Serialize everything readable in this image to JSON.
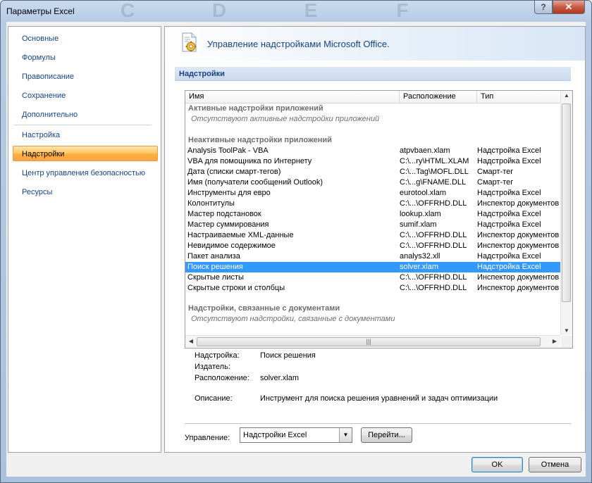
{
  "window": {
    "title": "Параметры Excel",
    "background_columns": [
      "C",
      "D",
      "E",
      "F"
    ],
    "help_glyph": "?",
    "close_glyph": "✕"
  },
  "nav": {
    "items": [
      {
        "label": "Основные",
        "active": false
      },
      {
        "label": "Формулы",
        "active": false
      },
      {
        "label": "Правописание",
        "active": false
      },
      {
        "label": "Сохранение",
        "active": false
      },
      {
        "label": "Дополнительно",
        "active": false
      },
      {
        "label": "Настройка",
        "active": false
      },
      {
        "label": "Надстройки",
        "active": true
      },
      {
        "label": "Центр управления безопасностью",
        "active": false
      },
      {
        "label": "Ресурсы",
        "active": false
      }
    ]
  },
  "main": {
    "banner_title": "Управление надстройками Microsoft Office.",
    "section_title": "Надстройки",
    "table": {
      "columns": [
        "Имя",
        "Расположение",
        "Тип"
      ],
      "active_group": {
        "title": "Активные надстройки приложений",
        "empty_text": "Отсутствуют активные надстройки приложений"
      },
      "inactive_group": {
        "title": "Неактивные надстройки приложений",
        "rows": [
          {
            "name": "Analysis ToolPak - VBA",
            "location": "atpvbaen.xlam",
            "type": "Надстройка Excel"
          },
          {
            "name": "VBA для помощника по Интернету",
            "location": "C:\\...ry\\HTML.XLAM",
            "type": "Надстройка Excel"
          },
          {
            "name": "Дата (списки смарт-тегов)",
            "location": "C:\\...Tag\\MOFL.DLL",
            "type": "Смарт-тег"
          },
          {
            "name": "Имя (получатели сообщений Outlook)",
            "location": "C:\\...g\\FNAME.DLL",
            "type": "Смарт-тег"
          },
          {
            "name": "Инструменты для евро",
            "location": "eurotool.xlam",
            "type": "Надстройка Excel"
          },
          {
            "name": "Колонтитулы",
            "location": "C:\\...\\OFFRHD.DLL",
            "type": "Инспектор документов"
          },
          {
            "name": "Мастер подстановок",
            "location": "lookup.xlam",
            "type": "Надстройка Excel"
          },
          {
            "name": "Мастер суммирования",
            "location": "sumif.xlam",
            "type": "Надстройка Excel"
          },
          {
            "name": "Настраиваемые XML-данные",
            "location": "C:\\...\\OFFRHD.DLL",
            "type": "Инспектор документов"
          },
          {
            "name": "Невидимое содержимое",
            "location": "C:\\...\\OFFRHD.DLL",
            "type": "Инспектор документов"
          },
          {
            "name": "Пакет анализа",
            "location": "analys32.xll",
            "type": "Надстройка Excel"
          },
          {
            "name": "Поиск решения",
            "location": "solver.xlam",
            "type": "Надстройка Excel",
            "selected": true
          },
          {
            "name": "Скрытые листы",
            "location": "C:\\...\\OFFRHD.DLL",
            "type": "Инспектор документов"
          },
          {
            "name": "Скрытые строки и столбцы",
            "location": "C:\\...\\OFFRHD.DLL",
            "type": "Инспектор документов"
          }
        ]
      },
      "doc_group": {
        "title": "Надстройки, связанные с документами",
        "empty_text": "Отсутствуют надстройки, связанные с документами"
      }
    },
    "details": {
      "addin_label": "Надстройка:",
      "addin_value": "Поиск решения",
      "publisher_label": "Издатель:",
      "publisher_value": "",
      "location_label": "Расположение:",
      "location_value": "solver.xlam",
      "description_label": "Описание:",
      "description_value": "Инструмент для поиска решения уравнений и задач оптимизации"
    },
    "manage": {
      "label": "Управление:",
      "selected": "Надстройки Excel",
      "go_button": "Перейти..."
    }
  },
  "footer": {
    "ok": "OK",
    "cancel": "Отмена"
  },
  "colors": {
    "link_blue": "#15428b",
    "selection": "#3399ff",
    "nav_active": "#ffc869"
  }
}
